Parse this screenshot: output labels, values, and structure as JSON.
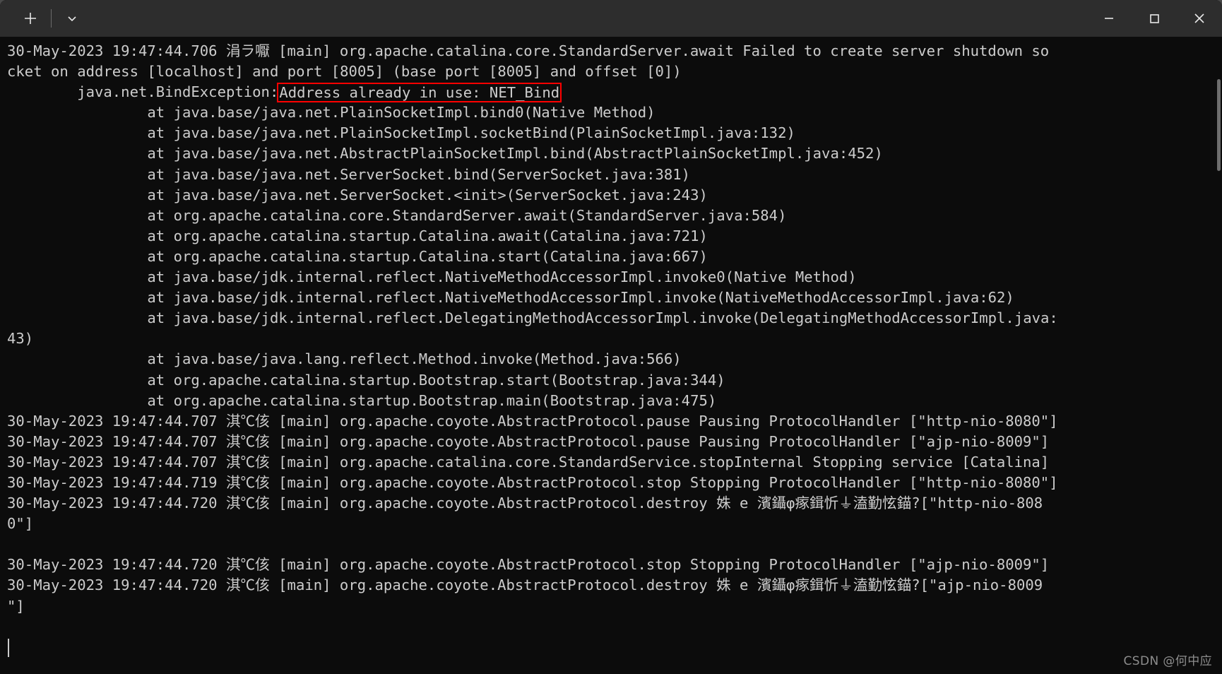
{
  "window": {
    "titlebar": {
      "new_tab_label": "+",
      "dropdown_label": "⌄",
      "minimize_label": "—",
      "maximize_label": "☐",
      "close_label": "✕"
    },
    "background_color": "#0c0c0c",
    "titlebar_color": "#2d2d2d",
    "text_color": "#cccccc",
    "highlight_color": "#ff0000"
  },
  "terminal": {
    "lines": [
      {
        "text": "30-May-2023 19:47:44.706 涓ラ嚈 [main] org.apache.catalina.core.StandardServer.await Failed to create server shutdown so"
      },
      {
        "text": "cket on address [localhost] and port [8005] (base port [8005] and offset [0])"
      },
      {
        "pre": "        java.net.BindException:",
        "highlight": "Address already in use: NET_Bind",
        "post": ""
      },
      {
        "text": "                at java.base/java.net.PlainSocketImpl.bind0(Native Method)"
      },
      {
        "text": "                at java.base/java.net.PlainSocketImpl.socketBind(PlainSocketImpl.java:132)"
      },
      {
        "text": "                at java.base/java.net.AbstractPlainSocketImpl.bind(AbstractPlainSocketImpl.java:452)"
      },
      {
        "text": "                at java.base/java.net.ServerSocket.bind(ServerSocket.java:381)"
      },
      {
        "text": "                at java.base/java.net.ServerSocket.<init>(ServerSocket.java:243)"
      },
      {
        "text": "                at org.apache.catalina.core.StandardServer.await(StandardServer.java:584)"
      },
      {
        "text": "                at org.apache.catalina.startup.Catalina.await(Catalina.java:721)"
      },
      {
        "text": "                at org.apache.catalina.startup.Catalina.start(Catalina.java:667)"
      },
      {
        "text": "                at java.base/jdk.internal.reflect.NativeMethodAccessorImpl.invoke0(Native Method)"
      },
      {
        "text": "                at java.base/jdk.internal.reflect.NativeMethodAccessorImpl.invoke(NativeMethodAccessorImpl.java:62)"
      },
      {
        "text": "                at java.base/jdk.internal.reflect.DelegatingMethodAccessorImpl.invoke(DelegatingMethodAccessorImpl.java:"
      },
      {
        "text": "43)"
      },
      {
        "text": "                at java.base/java.lang.reflect.Method.invoke(Method.java:566)"
      },
      {
        "text": "                at org.apache.catalina.startup.Bootstrap.start(Bootstrap.java:344)"
      },
      {
        "text": "                at org.apache.catalina.startup.Bootstrap.main(Bootstrap.java:475)"
      },
      {
        "text": "30-May-2023 19:47:44.707 淇℃侅 [main] org.apache.coyote.AbstractProtocol.pause Pausing ProtocolHandler [\"http-nio-8080\"]"
      },
      {
        "text": "30-May-2023 19:47:44.707 淇℃侅 [main] org.apache.coyote.AbstractProtocol.pause Pausing ProtocolHandler [\"ajp-nio-8009\"]"
      },
      {
        "text": "30-May-2023 19:47:44.707 淇℃侅 [main] org.apache.catalina.core.StandardService.stopInternal Stopping service [Catalina]"
      },
      {
        "text": "30-May-2023 19:47:44.719 淇℃侅 [main] org.apache.coyote.AbstractProtocol.stop Stopping ProtocolHandler [\"http-nio-8080\"]"
      },
      {
        "text": "30-May-2023 19:47:44.720 淇℃侅 [main] org.apache.coyote.AbstractProtocol.destroy 姝 e 濱鑷φ瘃鍓忻⏚溘勤怰錨?[\"http-nio-808"
      },
      {
        "text": "0\"]"
      },
      {
        "text": ""
      },
      {
        "text": "30-May-2023 19:47:44.720 淇℃侅 [main] org.apache.coyote.AbstractProtocol.stop Stopping ProtocolHandler [\"ajp-nio-8009\"]"
      },
      {
        "text": "30-May-2023 19:47:44.720 淇℃侅 [main] org.apache.coyote.AbstractProtocol.destroy 姝 e 濱鑷φ瘃鍓忻⏚溘勤怰錨?[\"ajp-nio-8009"
      },
      {
        "text": "\"]"
      }
    ]
  },
  "watermark": {
    "text": "CSDN @何中应"
  }
}
